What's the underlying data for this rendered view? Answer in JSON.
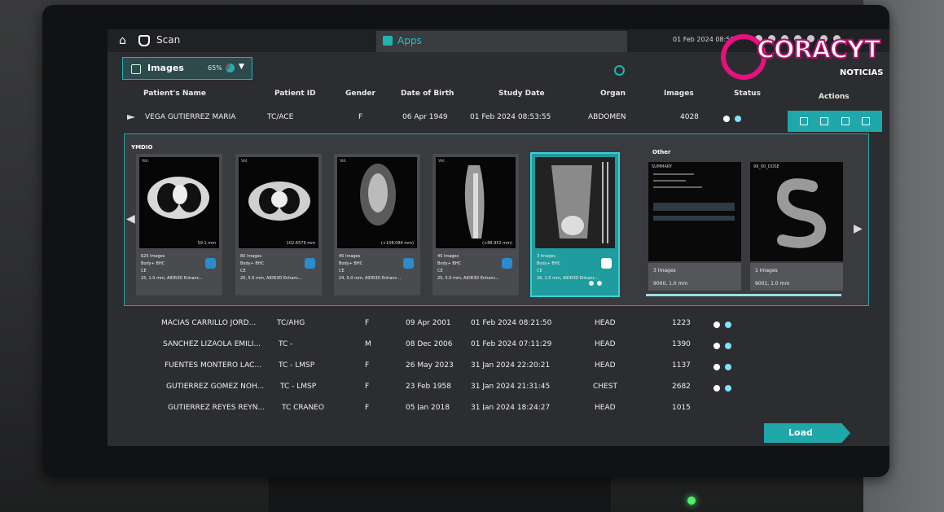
{
  "topbar": {
    "scan_label": "Scan",
    "apps_label": "Apps",
    "datetime": "01 Feb 2024 08:56"
  },
  "images_button": {
    "label": "Images",
    "percent": "65%",
    "percent_value": 0.65
  },
  "table": {
    "headers": [
      "Patient's Name",
      "Patient ID",
      "Gender",
      "Date of Birth",
      "Study Date",
      "Organ",
      "Images",
      "Status",
      "Actions"
    ],
    "selected_row": {
      "name": "VEGA GUTIERREZ MARIA",
      "id": "TC/ACE",
      "gender": "F",
      "dob": "06 Apr 1949",
      "study_date": "01 Feb 2024 08:53:55",
      "organ": "ABDOMEN",
      "images": "4028"
    },
    "rows": [
      {
        "name": "MACIAS CARRILLO JORD...",
        "id": "TC/AHG",
        "gender": "F",
        "dob": "09 Apr 2001",
        "study_date": "01 Feb 2024 08:21:50",
        "organ": "HEAD",
        "images": "1223"
      },
      {
        "name": "SANCHEZ LIZAOLA EMILI...",
        "id": "TC -",
        "gender": "M",
        "dob": "08 Dec 2006",
        "study_date": "01 Feb 2024 07:11:29",
        "organ": "HEAD",
        "images": "1390"
      },
      {
        "name": "FUENTES MONTERO LAC...",
        "id": "TC - LMSP",
        "gender": "F",
        "dob": "26 May 2023",
        "study_date": "31 Jan 2024 22:20:21",
        "organ": "HEAD",
        "images": "1137"
      },
      {
        "name": "GUTIERREZ GOMEZ NOH...",
        "id": "TC - LMSP",
        "gender": "F",
        "dob": "23 Feb 1958",
        "study_date": "31 Jan 2024 21:31:45",
        "organ": "CHEST",
        "images": "2682"
      },
      {
        "name": "GUTIERREZ REYES REYN...",
        "id": "TC CRANEO",
        "gender": "F",
        "dob": "05 Jan 2018",
        "study_date": "31 Jan 2024 18:24:27",
        "organ": "HEAD",
        "images": "1015"
      }
    ]
  },
  "series_panel": {
    "group_label": "YMDIO",
    "other_label": "Other",
    "series": [
      {
        "tag": "Vol.",
        "mm": "59.1 mm",
        "count": "625",
        "count_unit": "Images",
        "desc": "Body+ BHC",
        "kernel": "CE",
        "detail": "15, 1.0 mm, AIDR3D Enhanc..."
      },
      {
        "tag": "Vol.",
        "mm": "102.6579 mm",
        "count": "80",
        "count_unit": "Images",
        "desc": "Body+ BHC",
        "kernel": "CE",
        "detail": "20, 5.0 mm, AIDR3D Enhanc..."
      },
      {
        "tag": "Vol.",
        "mm": "(+108.084 mm)",
        "count": "40",
        "count_unit": "Images",
        "desc": "Body+ BHC",
        "kernel": "CE",
        "detail": "24, 5.0 mm, AIDR3D Enhanc..."
      },
      {
        "tag": "Vol.",
        "mm": "(+88.952 mm)",
        "count": "45",
        "count_unit": "Images",
        "desc": "Body+ BHC",
        "kernel": "CE",
        "detail": "25, 5.0 mm, AIDR3D Enhanc..."
      },
      {
        "tag": "",
        "mm": "",
        "count": "3",
        "count_unit": "Images",
        "desc": "Body+ BHC",
        "kernel": "CE",
        "detail": "26, 1.0 mm, AIDR3D Enhanc..."
      }
    ],
    "other": [
      {
        "tag": "SUMMARY",
        "count": "3",
        "count_unit": "Images",
        "detail": "9000, 1.0 mm"
      },
      {
        "tag": "99_00_DOSE",
        "count": "1",
        "count_unit": "Images",
        "detail": "9001, 1.0 mm"
      }
    ]
  },
  "load_label": "Load",
  "watermark": {
    "brand": "CORACYT",
    "sub": "NOTICIAS"
  }
}
